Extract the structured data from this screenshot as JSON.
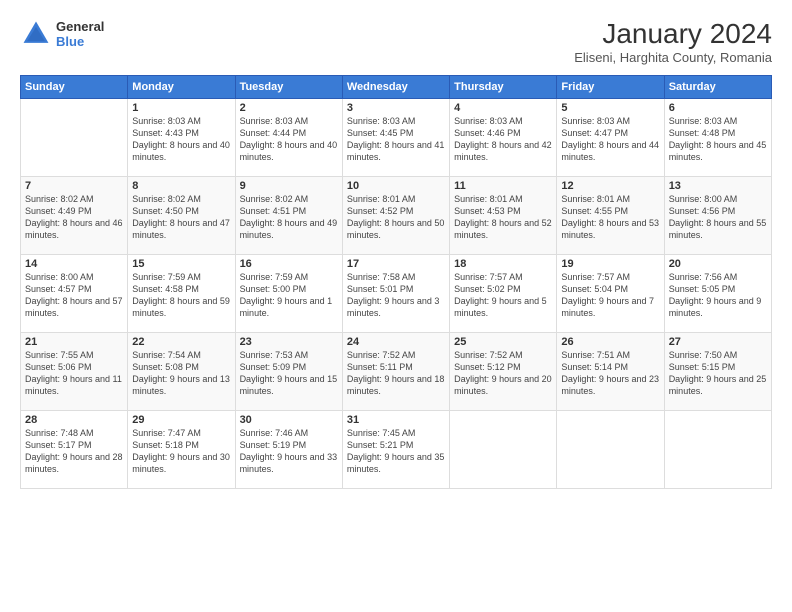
{
  "header": {
    "logo_general": "General",
    "logo_blue": "Blue",
    "month_year": "January 2024",
    "location": "Eliseni, Harghita County, Romania"
  },
  "weekdays": [
    "Sunday",
    "Monday",
    "Tuesday",
    "Wednesday",
    "Thursday",
    "Friday",
    "Saturday"
  ],
  "weeks": [
    [
      {
        "day": "",
        "sunrise": "",
        "sunset": "",
        "daylight": ""
      },
      {
        "day": "1",
        "sunrise": "Sunrise: 8:03 AM",
        "sunset": "Sunset: 4:43 PM",
        "daylight": "Daylight: 8 hours and 40 minutes."
      },
      {
        "day": "2",
        "sunrise": "Sunrise: 8:03 AM",
        "sunset": "Sunset: 4:44 PM",
        "daylight": "Daylight: 8 hours and 40 minutes."
      },
      {
        "day": "3",
        "sunrise": "Sunrise: 8:03 AM",
        "sunset": "Sunset: 4:45 PM",
        "daylight": "Daylight: 8 hours and 41 minutes."
      },
      {
        "day": "4",
        "sunrise": "Sunrise: 8:03 AM",
        "sunset": "Sunset: 4:46 PM",
        "daylight": "Daylight: 8 hours and 42 minutes."
      },
      {
        "day": "5",
        "sunrise": "Sunrise: 8:03 AM",
        "sunset": "Sunset: 4:47 PM",
        "daylight": "Daylight: 8 hours and 44 minutes."
      },
      {
        "day": "6",
        "sunrise": "Sunrise: 8:03 AM",
        "sunset": "Sunset: 4:48 PM",
        "daylight": "Daylight: 8 hours and 45 minutes."
      }
    ],
    [
      {
        "day": "7",
        "sunrise": "Sunrise: 8:02 AM",
        "sunset": "Sunset: 4:49 PM",
        "daylight": "Daylight: 8 hours and 46 minutes."
      },
      {
        "day": "8",
        "sunrise": "Sunrise: 8:02 AM",
        "sunset": "Sunset: 4:50 PM",
        "daylight": "Daylight: 8 hours and 47 minutes."
      },
      {
        "day": "9",
        "sunrise": "Sunrise: 8:02 AM",
        "sunset": "Sunset: 4:51 PM",
        "daylight": "Daylight: 8 hours and 49 minutes."
      },
      {
        "day": "10",
        "sunrise": "Sunrise: 8:01 AM",
        "sunset": "Sunset: 4:52 PM",
        "daylight": "Daylight: 8 hours and 50 minutes."
      },
      {
        "day": "11",
        "sunrise": "Sunrise: 8:01 AM",
        "sunset": "Sunset: 4:53 PM",
        "daylight": "Daylight: 8 hours and 52 minutes."
      },
      {
        "day": "12",
        "sunrise": "Sunrise: 8:01 AM",
        "sunset": "Sunset: 4:55 PM",
        "daylight": "Daylight: 8 hours and 53 minutes."
      },
      {
        "day": "13",
        "sunrise": "Sunrise: 8:00 AM",
        "sunset": "Sunset: 4:56 PM",
        "daylight": "Daylight: 8 hours and 55 minutes."
      }
    ],
    [
      {
        "day": "14",
        "sunrise": "Sunrise: 8:00 AM",
        "sunset": "Sunset: 4:57 PM",
        "daylight": "Daylight: 8 hours and 57 minutes."
      },
      {
        "day": "15",
        "sunrise": "Sunrise: 7:59 AM",
        "sunset": "Sunset: 4:58 PM",
        "daylight": "Daylight: 8 hours and 59 minutes."
      },
      {
        "day": "16",
        "sunrise": "Sunrise: 7:59 AM",
        "sunset": "Sunset: 5:00 PM",
        "daylight": "Daylight: 9 hours and 1 minute."
      },
      {
        "day": "17",
        "sunrise": "Sunrise: 7:58 AM",
        "sunset": "Sunset: 5:01 PM",
        "daylight": "Daylight: 9 hours and 3 minutes."
      },
      {
        "day": "18",
        "sunrise": "Sunrise: 7:57 AM",
        "sunset": "Sunset: 5:02 PM",
        "daylight": "Daylight: 9 hours and 5 minutes."
      },
      {
        "day": "19",
        "sunrise": "Sunrise: 7:57 AM",
        "sunset": "Sunset: 5:04 PM",
        "daylight": "Daylight: 9 hours and 7 minutes."
      },
      {
        "day": "20",
        "sunrise": "Sunrise: 7:56 AM",
        "sunset": "Sunset: 5:05 PM",
        "daylight": "Daylight: 9 hours and 9 minutes."
      }
    ],
    [
      {
        "day": "21",
        "sunrise": "Sunrise: 7:55 AM",
        "sunset": "Sunset: 5:06 PM",
        "daylight": "Daylight: 9 hours and 11 minutes."
      },
      {
        "day": "22",
        "sunrise": "Sunrise: 7:54 AM",
        "sunset": "Sunset: 5:08 PM",
        "daylight": "Daylight: 9 hours and 13 minutes."
      },
      {
        "day": "23",
        "sunrise": "Sunrise: 7:53 AM",
        "sunset": "Sunset: 5:09 PM",
        "daylight": "Daylight: 9 hours and 15 minutes."
      },
      {
        "day": "24",
        "sunrise": "Sunrise: 7:52 AM",
        "sunset": "Sunset: 5:11 PM",
        "daylight": "Daylight: 9 hours and 18 minutes."
      },
      {
        "day": "25",
        "sunrise": "Sunrise: 7:52 AM",
        "sunset": "Sunset: 5:12 PM",
        "daylight": "Daylight: 9 hours and 20 minutes."
      },
      {
        "day": "26",
        "sunrise": "Sunrise: 7:51 AM",
        "sunset": "Sunset: 5:14 PM",
        "daylight": "Daylight: 9 hours and 23 minutes."
      },
      {
        "day": "27",
        "sunrise": "Sunrise: 7:50 AM",
        "sunset": "Sunset: 5:15 PM",
        "daylight": "Daylight: 9 hours and 25 minutes."
      }
    ],
    [
      {
        "day": "28",
        "sunrise": "Sunrise: 7:48 AM",
        "sunset": "Sunset: 5:17 PM",
        "daylight": "Daylight: 9 hours and 28 minutes."
      },
      {
        "day": "29",
        "sunrise": "Sunrise: 7:47 AM",
        "sunset": "Sunset: 5:18 PM",
        "daylight": "Daylight: 9 hours and 30 minutes."
      },
      {
        "day": "30",
        "sunrise": "Sunrise: 7:46 AM",
        "sunset": "Sunset: 5:19 PM",
        "daylight": "Daylight: 9 hours and 33 minutes."
      },
      {
        "day": "31",
        "sunrise": "Sunrise: 7:45 AM",
        "sunset": "Sunset: 5:21 PM",
        "daylight": "Daylight: 9 hours and 35 minutes."
      },
      {
        "day": "",
        "sunrise": "",
        "sunset": "",
        "daylight": ""
      },
      {
        "day": "",
        "sunrise": "",
        "sunset": "",
        "daylight": ""
      },
      {
        "day": "",
        "sunrise": "",
        "sunset": "",
        "daylight": ""
      }
    ]
  ]
}
